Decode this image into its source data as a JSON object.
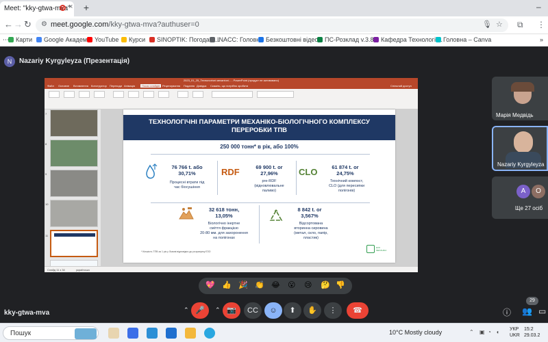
{
  "browser": {
    "tab_title": "Meet: \"kky-gtwa-mva\"",
    "tab_close": "×",
    "new_tab": "+",
    "window_control": "–",
    "url_host": "meet.google.com",
    "url_path": "/kky-gtwa-mva?authuser=0",
    "bookmarks": [
      {
        "label": "Карти",
        "color": "#34a853"
      },
      {
        "label": "Google Академія",
        "color": "#4285f4"
      },
      {
        "label": "YouTube",
        "color": "#ff0000"
      },
      {
        "label": "Курси",
        "color": "#fbbc05"
      },
      {
        "label": "SINOPTIK: Погода в...",
        "color": "#d93025"
      },
      {
        "label": "INACC: Головна",
        "color": "#5f6368"
      },
      {
        "label": "Безкоштовні відео...",
        "color": "#1a73e8"
      },
      {
        "label": "ПС-Розклад v.3.8.2",
        "color": "#0b8043"
      },
      {
        "label": "Кафедра Технології...",
        "color": "#7b1fa2"
      },
      {
        "label": "Головна – Canva",
        "color": "#00c4cc"
      }
    ],
    "bookmarks_more": "»"
  },
  "meet": {
    "presenter_initial": "N",
    "presenter_title": "Nazariy Kyrgyleyza (Презентація)",
    "meeting_code": "kky-gtwa-mva",
    "participants": [
      {
        "name": "Марія Медвідь"
      },
      {
        "name": "Nazariy Kyrgyleyza"
      }
    ],
    "others_avatars": [
      "A",
      "O"
    ],
    "others_label": "Ще 27 осіб",
    "participant_count": "29",
    "reactions": [
      "💖",
      "👍",
      "🎉",
      "👏",
      "😂",
      "😮",
      "😢",
      "🤔",
      "👎"
    ]
  },
  "powerpoint": {
    "title": "2023_01_25_Технологічні механічні... - PowerPoint (продукт не активовано)",
    "menu": [
      "Файл",
      "Основне",
      "Вставлення",
      "Конструктор",
      "Переходи",
      "Анімація",
      "Показ слайдів",
      "Рецензування",
      "Подання",
      "Довідка",
      "Скажіть, що потрібно зробити"
    ],
    "active_menu": "Показ слайдів",
    "share_label": "Спільний доступ",
    "status_left": "Слайд 11 з 34",
    "status_lang": "українська",
    "thumb_numbers": [
      "7",
      "8",
      "9",
      "10",
      "11",
      "12",
      "13"
    ]
  },
  "slide": {
    "title_line1": "ТЕХНОЛОГІЧНІ ПАРАМЕТРИ МЕХАНІКО-БІОЛОГІЧНОГО КОМПЛЕКСУ",
    "title_line2": "ПЕРЕРОБКИ ТПВ",
    "subtitle": "250 000 тонн* в рік, або 100%",
    "items": [
      {
        "value1": "76 766 t. або",
        "value2": "30,71%",
        "desc1": "Процесні втрати під",
        "desc2": "час біосушіння",
        "desc3": ""
      },
      {
        "tag": "RDF",
        "value1": "69 900 t. or",
        "value2": "27,96%",
        "desc1": "pre-RDF",
        "desc2": "(відновлювальне",
        "desc3": "паливо)"
      },
      {
        "tag": "CLO",
        "value1": "61 874 t. or",
        "value2": "24,75%",
        "desc1": "Технічний компост,",
        "desc2": "CLO (для пересипки",
        "desc3": "полігонів)"
      },
      {
        "value1": "32 618 тонн,",
        "value2": "13,05%",
        "desc1": "Біологічно інертне",
        "desc2": "сміття фракцією",
        "desc3": "20-80 мм. для захоронення",
        "desc4": "на полігонах"
      },
      {
        "value1": "8 842 t. or",
        "value2": "3,567%",
        "desc1": "Відсортована",
        "desc2": "вторинна сировина",
        "desc3": "(метал, скло, папір,",
        "desc4": "пластик)"
      }
    ],
    "footnote": "* Кількість ТПВ за 1 рік у Львові відповідно до розрахунку ЕЗО",
    "logo_text": "ЕКО\nМЕХАНІКА"
  },
  "taskbar": {
    "search_label": "Пошук",
    "weather": "10°C  Mostly cloudy",
    "lang_line1": "УКР",
    "lang_line2": "UKR",
    "time": "15:2",
    "date": "29.03.2"
  }
}
